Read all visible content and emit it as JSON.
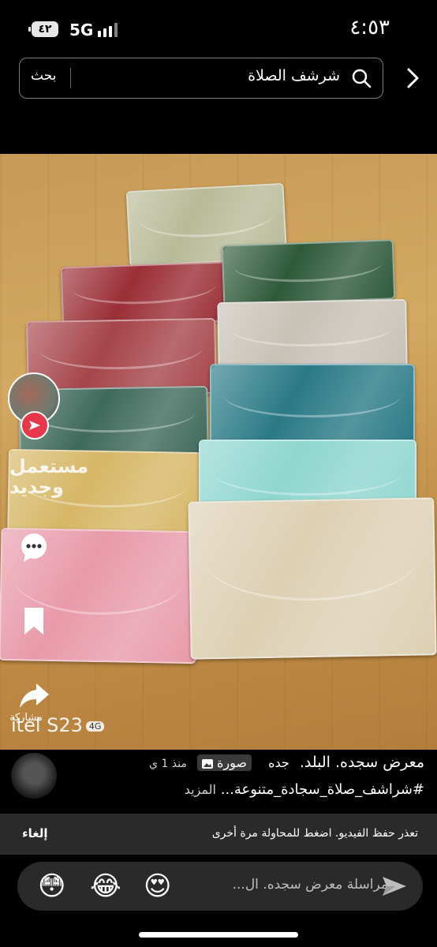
{
  "status_bar": {
    "time": "٤:٥٣",
    "network": "5G",
    "battery": "٤٢"
  },
  "search": {
    "query": "شرشف الصلاة",
    "button_label": "بحث"
  },
  "photo": {
    "watermark_text_1": "مستعمل",
    "watermark_text_2": "وجديد",
    "camera_watermark": "itel S23",
    "camera_badge": "4G",
    "mat_colors": [
      "#b8bb98",
      "#9a2f36",
      "#2f5a3a",
      "#a6454a",
      "#c8c1b6",
      "#3f6a5b",
      "#2a7a86",
      "#d6b766",
      "#8fd6cf",
      "#e89aaa",
      "#ddd0b4"
    ]
  },
  "actions": {
    "share_label": "مشاركة"
  },
  "post": {
    "title": "معرض سجده. البلد.",
    "city": "جده",
    "photo_tag": "صورة",
    "time_ago": "منذ 1 ي",
    "hashtag": "#شراشف_صلاة_سجادة_متنوعة...",
    "more": "المزيد"
  },
  "error": {
    "message": "تعذر حفظ الفيديو. اضغط للمحاولة مرة أخرى",
    "cancel": "إلغاء"
  },
  "message_bar": {
    "placeholder": "مراسلة معرض سجده. ال...",
    "emojis": [
      "😍",
      "😂",
      "😳"
    ]
  }
}
